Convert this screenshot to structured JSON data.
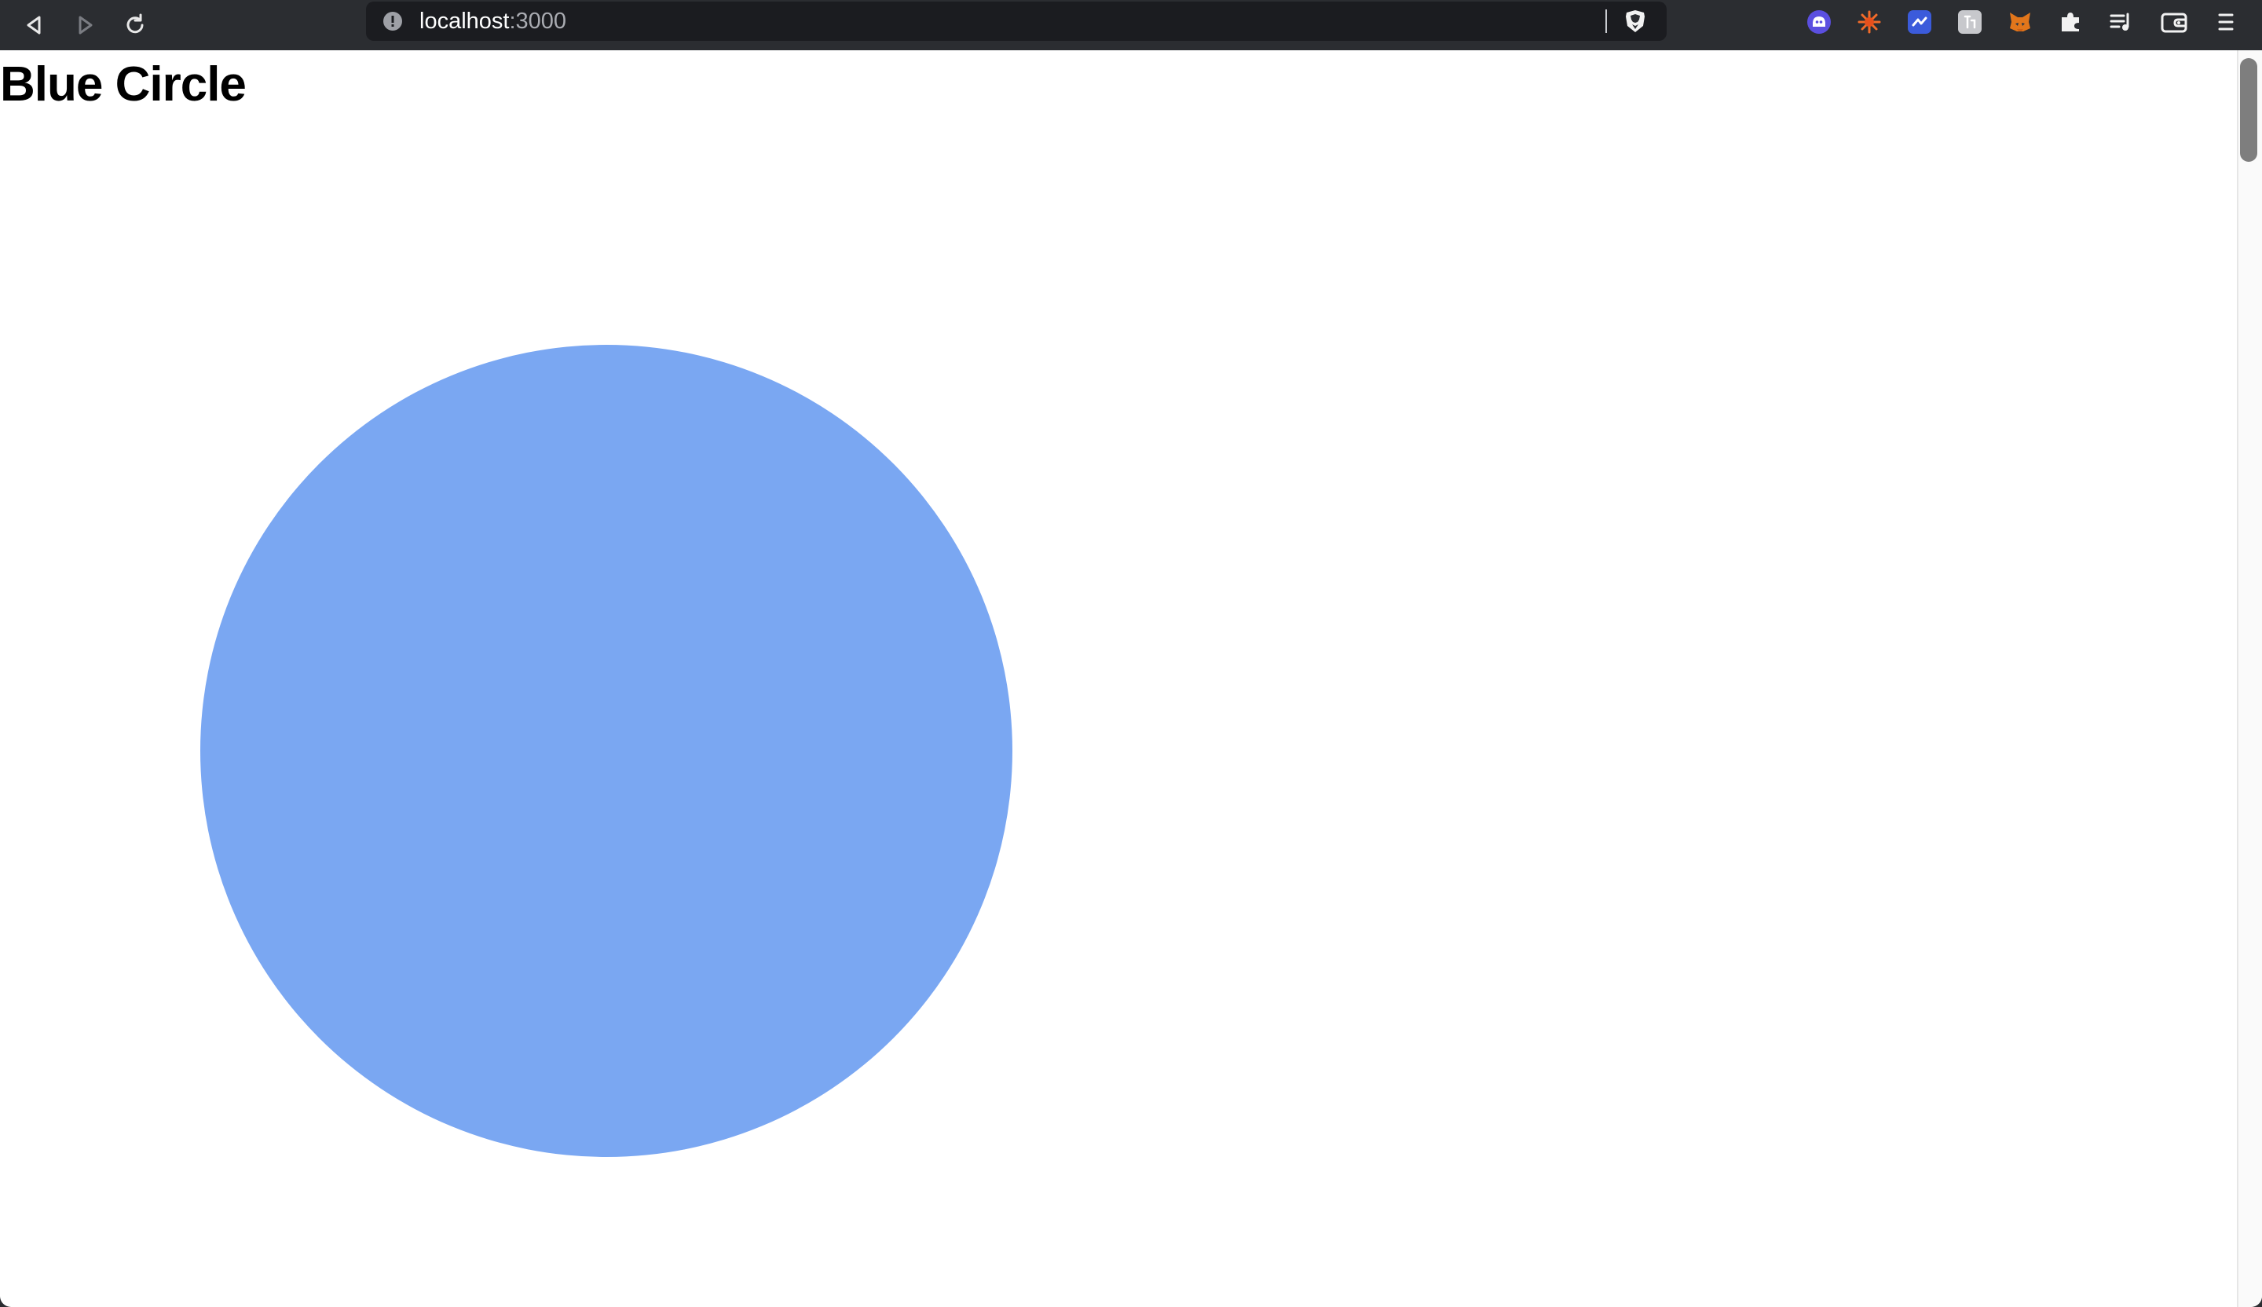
{
  "browser": {
    "url_host": "localhost",
    "url_port": ":3000"
  },
  "page": {
    "title": "Blue Circle",
    "circle_color": "#7aa7f2"
  },
  "toolbar_icons": {
    "navigation": [
      "back-icon",
      "forward-icon",
      "reload-icon"
    ],
    "extensions": [
      "ghost-extension-icon",
      "burst-extension-icon",
      "link-extension-icon",
      "translate-extension-icon",
      "fox-extension-icon",
      "puzzle-icon",
      "playlist-icon",
      "wallet-icon",
      "menu-icon"
    ]
  }
}
